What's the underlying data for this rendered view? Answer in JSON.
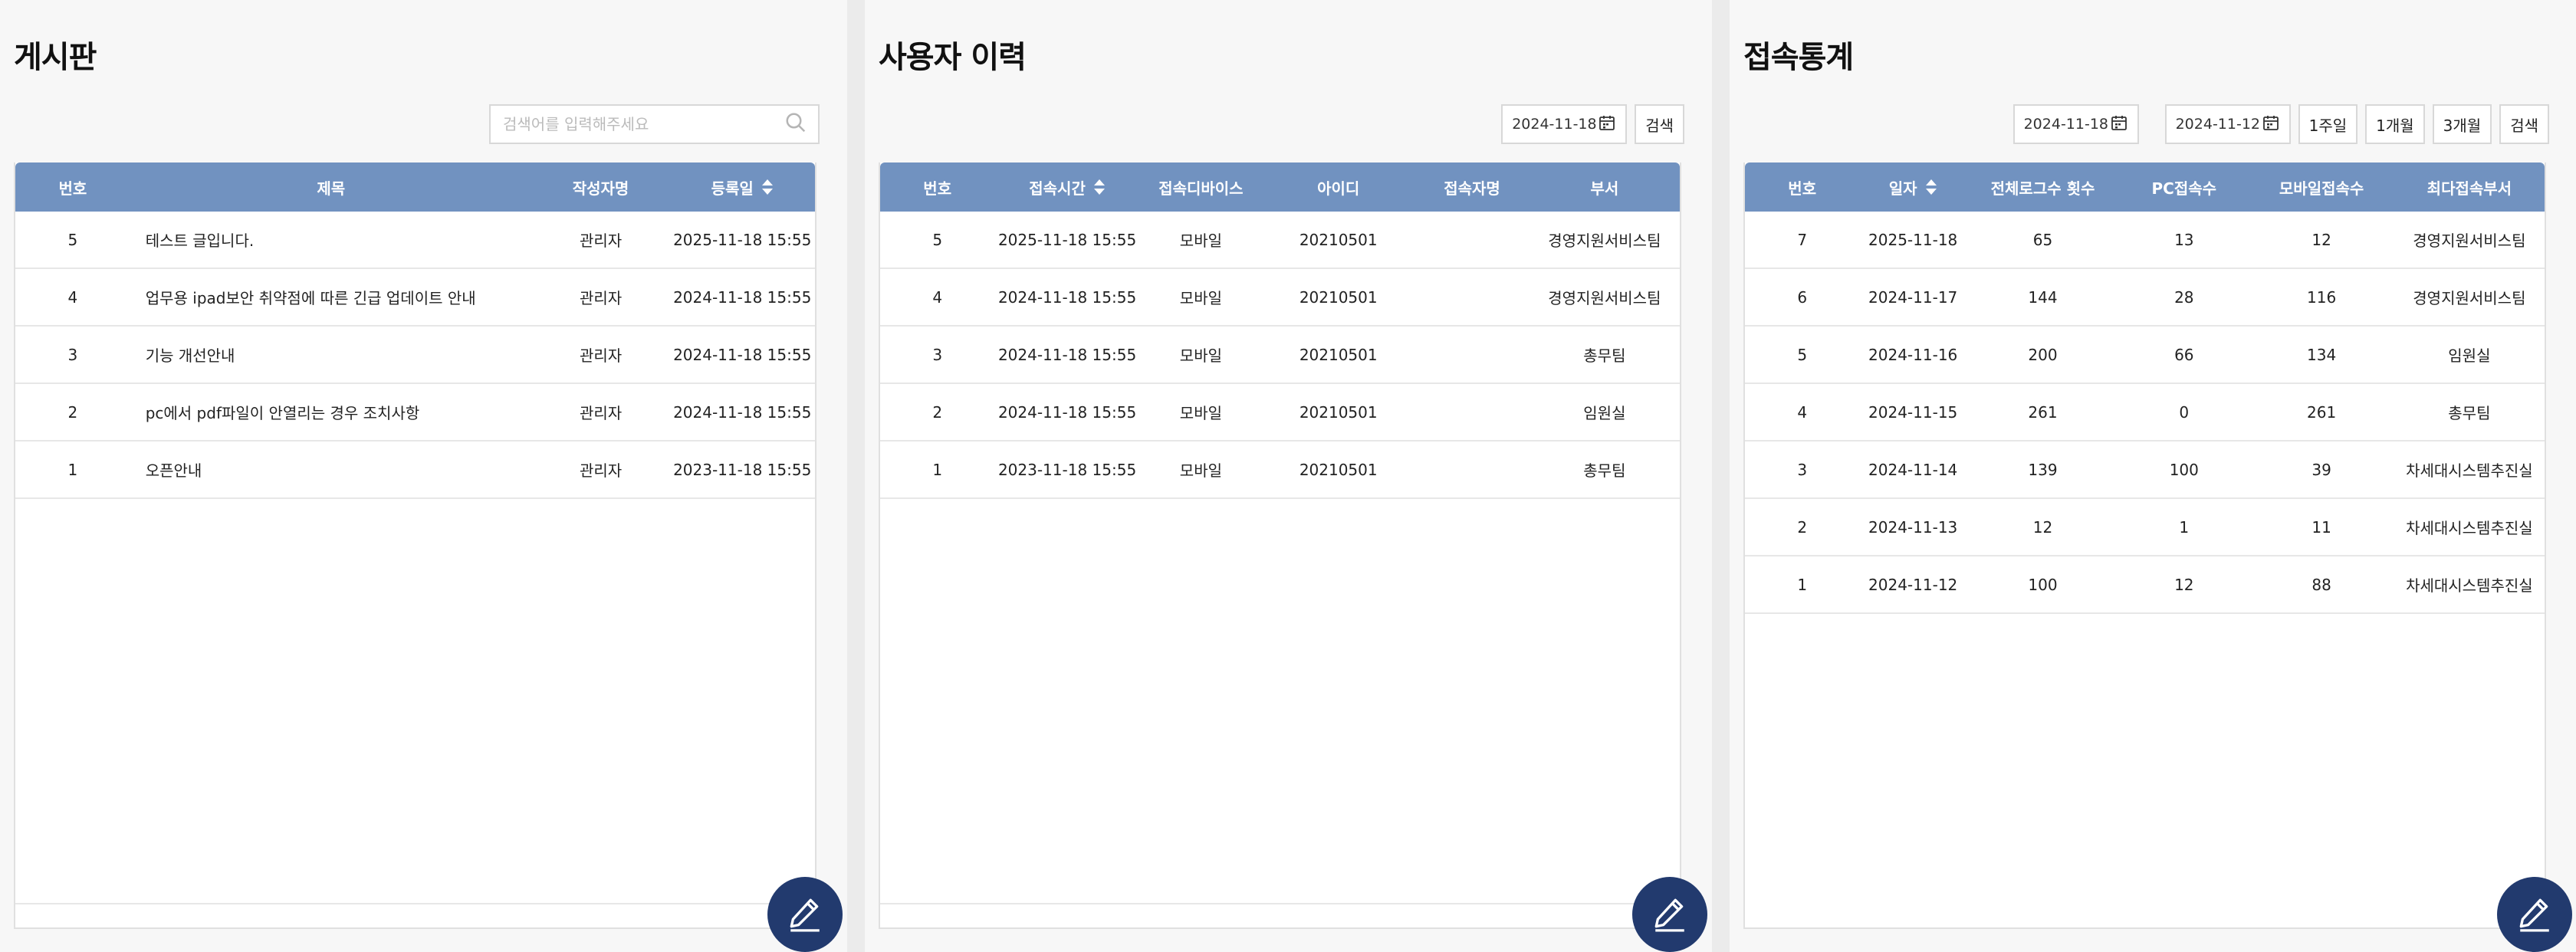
{
  "board": {
    "title": "게시판",
    "search_placeholder": "검색어를 입력해주세요",
    "columns": [
      "번호",
      "제목",
      "작성자명",
      "등록일"
    ],
    "rows": [
      {
        "no": "5",
        "title": "테스트 글입니다.",
        "author": "관리자",
        "date": "2025-11-18 15:55"
      },
      {
        "no": "4",
        "title": "업무용 ipad보안 취약점에 따른 긴급 업데이트 안내",
        "author": "관리자",
        "date": "2024-11-18 15:55"
      },
      {
        "no": "3",
        "title": "기능 개선안내",
        "author": "관리자",
        "date": "2024-11-18 15:55"
      },
      {
        "no": "2",
        "title": "pc에서 pdf파일이 안열리는 경우 조치사항",
        "author": "관리자",
        "date": "2024-11-18 15:55"
      },
      {
        "no": "1",
        "title": "오픈안내",
        "author": "관리자",
        "date": "2023-11-18 15:55"
      }
    ]
  },
  "history": {
    "title": "사용자 이력",
    "date": "2024-11-18",
    "search_label": "검색",
    "columns": [
      "번호",
      "접속시간",
      "접속디바이스",
      "아이디",
      "접속자명",
      "부서"
    ],
    "rows": [
      {
        "no": "5",
        "time": "2025-11-18 15:55",
        "device": "모바일",
        "id": "20210501",
        "name": "",
        "dept": "경영지원서비스팀"
      },
      {
        "no": "4",
        "time": "2024-11-18 15:55",
        "device": "모바일",
        "id": "20210501",
        "name": "",
        "dept": "경영지원서비스팀"
      },
      {
        "no": "3",
        "time": "2024-11-18 15:55",
        "device": "모바일",
        "id": "20210501",
        "name": "",
        "dept": "총무팀"
      },
      {
        "no": "2",
        "time": "2024-11-18 15:55",
        "device": "모바일",
        "id": "20210501",
        "name": "",
        "dept": "임원실"
      },
      {
        "no": "1",
        "time": "2023-11-18 15:55",
        "device": "모바일",
        "id": "20210501",
        "name": "",
        "dept": "총무팀"
      }
    ]
  },
  "stats": {
    "title": "접속통계",
    "date_from": "2024-11-18",
    "date_to": "2024-11-12",
    "range_buttons": [
      "1주일",
      "1개월",
      "3개월"
    ],
    "search_label": "검색",
    "columns": [
      "번호",
      "일자",
      "전체로그수 횟수",
      "PC접속수",
      "모바일접속수",
      "최다접속부서"
    ],
    "rows": [
      {
        "no": "7",
        "date": "2025-11-18",
        "total": "65",
        "pc": "13",
        "mobile": "12",
        "dept": "경영지원서비스팀"
      },
      {
        "no": "6",
        "date": "2024-11-17",
        "total": "144",
        "pc": "28",
        "mobile": "116",
        "dept": "경영지원서비스팀"
      },
      {
        "no": "5",
        "date": "2024-11-16",
        "total": "200",
        "pc": "66",
        "mobile": "134",
        "dept": "임원실"
      },
      {
        "no": "4",
        "date": "2024-11-15",
        "total": "261",
        "pc": "0",
        "mobile": "261",
        "dept": "총무팀"
      },
      {
        "no": "3",
        "date": "2024-11-14",
        "total": "139",
        "pc": "100",
        "mobile": "39",
        "dept": "차세대시스템추진실"
      },
      {
        "no": "2",
        "date": "2024-11-13",
        "total": "12",
        "pc": "1",
        "mobile": "11",
        "dept": "차세대시스템추진실"
      },
      {
        "no": "1",
        "date": "2024-11-12",
        "total": "100",
        "pc": "12",
        "mobile": "88",
        "dept": "차세대시스템추진실"
      }
    ]
  },
  "icons": {
    "search": "search-icon",
    "calendar": "calendar-icon",
    "sort": "sort-icon",
    "edit": "edit-pencil-icon"
  },
  "colors": {
    "table_header": "#7192c0",
    "fab": "#223a6e"
  }
}
